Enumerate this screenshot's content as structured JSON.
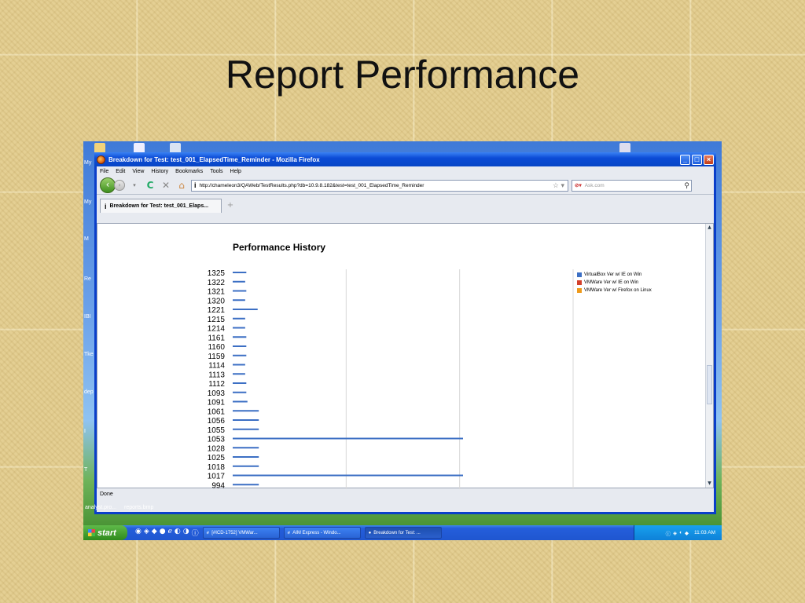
{
  "slide": {
    "title": "Report Performance"
  },
  "desktop": {
    "left_labels": [
      "My",
      "My",
      "M",
      "Re",
      "IBI",
      "Tke",
      "dep",
      "I",
      "T"
    ],
    "bottom_labels": [
      "analyst.pro...",
      "reports.bmp"
    ]
  },
  "browser": {
    "window_title": "Breakdown for Test: test_001_ElapsedTime_Reminder - Mozilla Firefox",
    "menu": [
      "File",
      "Edit",
      "View",
      "History",
      "Bookmarks",
      "Tools",
      "Help"
    ],
    "url": "http://chameleon3/QAWeb/TestResults.php?db=10.9.8.182&test=test_001_ElapsedTime_Reminder",
    "search_placeholder": "Ask.com",
    "tab_label": "Breakdown for Test: test_001_Elaps...",
    "status": "Done",
    "icons": {
      "back": "back-arrow-icon",
      "forward": "forward-arrow-icon",
      "reload": "reload-icon",
      "stop": "stop-icon",
      "home": "home-icon",
      "info": "info-icon",
      "bookmark": "star-icon",
      "search": "magnifier-icon"
    }
  },
  "chart_data": {
    "type": "bar",
    "orientation": "horizontal",
    "title": "Performance History",
    "categories": [
      "1325",
      "1322",
      "1321",
      "1320",
      "1221",
      "1215",
      "1214",
      "1161",
      "1160",
      "1159",
      "1114",
      "1113",
      "1112",
      "1093",
      "1091",
      "1061",
      "1056",
      "1055",
      "1053",
      "1028",
      "1025",
      "1018",
      "1017",
      "994"
    ],
    "series": [
      {
        "name": "VirtualBox Ver w/ IE on Win",
        "color": "#3c6fc4",
        "values": [
          1.2,
          1.1,
          1.2,
          1.1,
          2.2,
          1.1,
          1.1,
          1.2,
          1.2,
          1.2,
          1.1,
          1.1,
          1.2,
          1.2,
          1.3,
          2.3,
          2.3,
          2.3,
          20.3,
          2.3,
          2.3,
          2.3,
          20.3,
          2.3
        ]
      },
      {
        "name": "VMWare Ver w/ IE on Win",
        "color": "#d3402b",
        "values": []
      },
      {
        "name": "VMWare Ver w/ Firefox on Linux",
        "color": "#ee9a1b",
        "values": []
      }
    ],
    "xlim": [
      0,
      30
    ],
    "grid": true,
    "legend": "right"
  },
  "taskbar": {
    "start_label": "start",
    "tasks": [
      "[#ICD-1752] VMWar...",
      "AIM Express - Windo...",
      "Breakdown for Test: ..."
    ],
    "clock": "11:03 AM"
  }
}
